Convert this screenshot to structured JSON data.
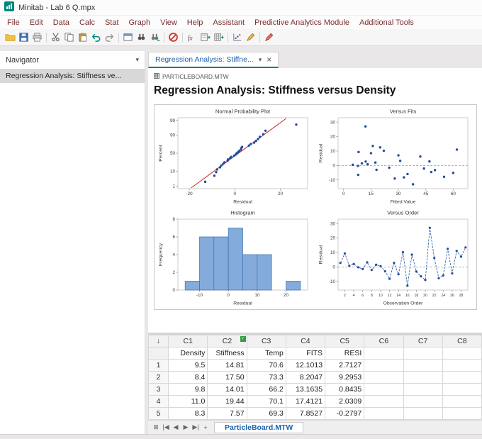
{
  "window": {
    "title": "Minitab - Lab 6 Q.mpx"
  },
  "menu": {
    "items": [
      "File",
      "Edit",
      "Data",
      "Calc",
      "Stat",
      "Graph",
      "View",
      "Help",
      "Assistant",
      "Predictive Analytics Module",
      "Additional Tools"
    ]
  },
  "toolbar": {
    "groups": [
      [
        "open-file",
        "save-file",
        "print"
      ],
      [
        "cut",
        "copy",
        "paste",
        "undo",
        "redo"
      ],
      [
        "last-dialog",
        "find",
        "replace"
      ],
      [
        "stop"
      ],
      [
        "fx-calculator",
        "session-fold",
        "worksheet-fold"
      ],
      [
        "scatterplot",
        "brush"
      ],
      [
        "highlight"
      ]
    ]
  },
  "navigator": {
    "title": "Navigator",
    "chevron": "▾",
    "items": [
      {
        "label": "Regression Analysis: Stiffness ve...",
        "selected": true
      }
    ]
  },
  "doc_tab": {
    "label": "Regression Analysis: Stiffne...",
    "chevron": "▾",
    "close": "×"
  },
  "output": {
    "worksheet_label": "PARTICLEBOARD.MTW",
    "heading": "Regression Analysis: Stiffness versus Density"
  },
  "worksheet": {
    "corner_glyph": "↓",
    "columns": [
      {
        "id": "C1",
        "name": "Density"
      },
      {
        "id": "C2",
        "name": "Stiffness",
        "marker": true
      },
      {
        "id": "C3",
        "name": "Temp"
      },
      {
        "id": "C4",
        "name": "FITS"
      },
      {
        "id": "C5",
        "name": "RESI"
      },
      {
        "id": "C6",
        "name": ""
      },
      {
        "id": "C7",
        "name": ""
      },
      {
        "id": "C8",
        "name": ""
      }
    ],
    "rows": [
      {
        "n": "1",
        "values": [
          "9.5",
          "14.81",
          "70.6",
          "12.1013",
          "2.7127",
          "",
          "",
          ""
        ]
      },
      {
        "n": "2",
        "values": [
          "8.4",
          "17.50",
          "73.3",
          "8.2047",
          "9.2953",
          "",
          "",
          ""
        ]
      },
      {
        "n": "3",
        "values": [
          "9.8",
          "14.01",
          "66.2",
          "13.1635",
          "0.8435",
          "",
          "",
          ""
        ]
      },
      {
        "n": "4",
        "values": [
          "11.0",
          "19.44",
          "70.1",
          "17.4121",
          "2.0309",
          "",
          "",
          ""
        ]
      },
      {
        "n": "5",
        "values": [
          "8.3",
          "7.57",
          "69.3",
          "7.8527",
          "-0.2797",
          "",
          "",
          ""
        ]
      }
    ],
    "sheet_nav": [
      {
        "name": "worksheet-grid",
        "glyph": "⊞"
      },
      {
        "name": "first-row",
        "glyph": "|◀"
      },
      {
        "name": "prev-row",
        "glyph": "◀"
      },
      {
        "name": "next-row",
        "glyph": "▶"
      },
      {
        "name": "last-row",
        "glyph": "▶|"
      },
      {
        "name": "add-worksheet",
        "glyph": "+"
      }
    ],
    "sheet_tab": "ParticleBoard.MTW"
  },
  "colors": {
    "accent_teal": "#00857c",
    "tab_blue": "#1b61ad",
    "menu_text": "#7b2c2c",
    "point": "#1f4e9e",
    "fit_line": "#cc2222",
    "bar_fill": "#84abdb",
    "bar_edge": "#3c6eae",
    "order_line": "#2456a4",
    "zero_line": "#9b9b9b"
  },
  "chart_data": [
    {
      "type": "scatter",
      "variant": "normal-probability",
      "title": "Normal Probability Plot",
      "xlabel": "Residual",
      "ylabel": "Percent",
      "x_ticks": [
        -20,
        0,
        20
      ],
      "y_tick_percents": [
        1,
        10,
        50,
        90,
        99
      ],
      "xlim": [
        -25,
        32
      ],
      "fit_line": true,
      "residuals": [
        2.7127,
        9.2953,
        0.8435,
        2.0309,
        -0.2797,
        -1.5,
        3.2,
        -2.1,
        1.5,
        0.5,
        -3.0,
        -8.2,
        2.8,
        -5.1,
        10.2,
        -13.0,
        8.5,
        -3.2,
        -6.5,
        -9.0,
        27.0,
        6.2,
        -7.8,
        -5.9,
        12.5,
        -4.5,
        11.0,
        7.0,
        13.5
      ]
    },
    {
      "type": "scatter",
      "variant": "versus-fits",
      "title": "Versus Fits",
      "xlabel": "Fitted Value",
      "ylabel": "Residual",
      "x_ticks": [
        0,
        15,
        30,
        45,
        60
      ],
      "y_ticks": [
        -10,
        0,
        10,
        20,
        30
      ],
      "xlim": [
        -3,
        68
      ],
      "ylim": [
        -16,
        33
      ],
      "zero_line": true,
      "x": [
        12.1013,
        8.2047,
        13.1635,
        17.4121,
        7.8527,
        25,
        31,
        44,
        10,
        5,
        18,
        33,
        47,
        60,
        22,
        38,
        15,
        50,
        8,
        28,
        12,
        42,
        55,
        35,
        20,
        48,
        62,
        30,
        16
      ],
      "y": [
        2.7127,
        9.2953,
        0.8435,
        2.0309,
        -0.2797,
        -1.5,
        3.2,
        -2.1,
        1.5,
        0.5,
        -3.0,
        -8.2,
        2.8,
        -5.1,
        10.2,
        -13.0,
        8.5,
        -3.2,
        -6.5,
        -9.0,
        27.0,
        6.2,
        -7.8,
        -5.9,
        12.5,
        -4.5,
        11.0,
        7.0,
        13.5
      ]
    },
    {
      "type": "bar",
      "variant": "histogram",
      "title": "Histogram",
      "xlabel": "Residual",
      "ylabel": "Frequency",
      "bin_width": 5,
      "bins": [
        {
          "left": -15,
          "count": 1
        },
        {
          "left": -10,
          "count": 6
        },
        {
          "left": -5,
          "count": 6
        },
        {
          "left": 0,
          "count": 7
        },
        {
          "left": 5,
          "count": 4
        },
        {
          "left": 10,
          "count": 4
        },
        {
          "left": 20,
          "count": 1
        }
      ],
      "x_ticks": [
        -10,
        0,
        10,
        20
      ],
      "y_ticks": [
        0,
        2,
        4,
        6,
        8
      ],
      "xlim": [
        -17.5,
        27.5
      ],
      "ylim": [
        0,
        8
      ]
    },
    {
      "type": "line",
      "variant": "versus-order",
      "title": "Versus Order",
      "xlabel": "Observation Order",
      "ylabel": "Residual",
      "x_ticks": [
        2,
        4,
        6,
        8,
        10,
        12,
        14,
        16,
        18,
        20,
        22,
        24,
        26,
        28
      ],
      "y_ticks": [
        -10,
        0,
        10,
        20,
        30
      ],
      "xlim": [
        0.5,
        29.5
      ],
      "ylim": [
        -16,
        33
      ],
      "zero_line": true,
      "y": [
        2.7127,
        9.2953,
        0.8435,
        2.0309,
        -0.2797,
        -1.5,
        3.2,
        -2.1,
        1.5,
        0.5,
        -3.0,
        -8.2,
        2.8,
        -5.1,
        10.2,
        -13.0,
        8.5,
        -3.2,
        -6.5,
        -9.0,
        27.0,
        6.2,
        -7.8,
        -5.9,
        12.5,
        -4.5,
        11.0,
        7.0,
        13.5
      ]
    }
  ]
}
